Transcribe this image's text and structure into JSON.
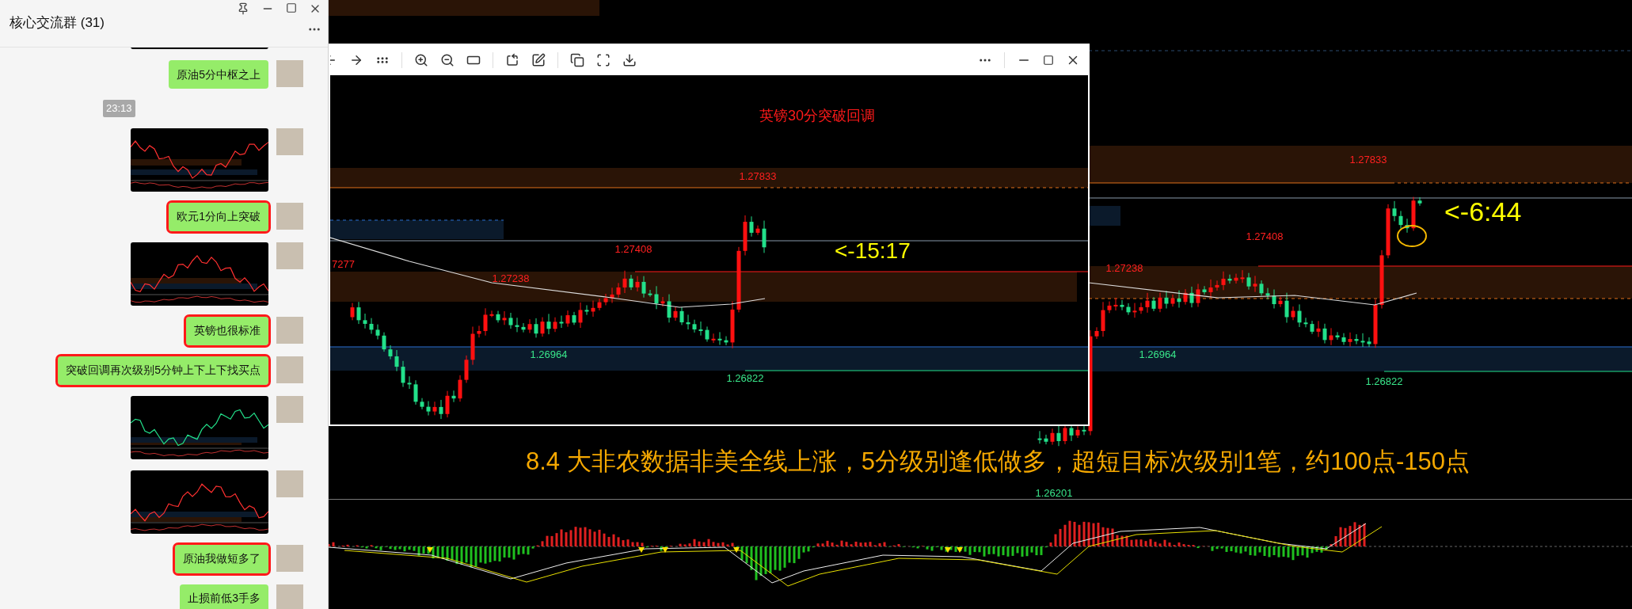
{
  "chat": {
    "title": "核心交流群 (31)",
    "messages": [
      {
        "kind": "image"
      },
      {
        "kind": "text",
        "text": "原油5分中枢之上",
        "highlighted": false
      },
      {
        "kind": "time",
        "text": "23:13"
      },
      {
        "kind": "image"
      },
      {
        "kind": "text",
        "text": "欧元1分向上突破",
        "highlighted": true
      },
      {
        "kind": "image"
      },
      {
        "kind": "text",
        "text": "英镑也很标准",
        "highlighted": true
      },
      {
        "kind": "text",
        "text": "突破回调再次级别5分钟上下上下找买点",
        "highlighted": true
      },
      {
        "kind": "image"
      },
      {
        "kind": "image"
      },
      {
        "kind": "text",
        "text": "原油我做短多了",
        "highlighted": true
      },
      {
        "kind": "text",
        "text": "止损前低3手多",
        "highlighted": false
      }
    ]
  },
  "viewer": {
    "title": "英镑30分突破回调",
    "annotation": "<-15:17",
    "labels": [
      {
        "text": "1.27833",
        "color": "#ff2020"
      },
      {
        "text": "1.27408",
        "color": "#ff2020"
      },
      {
        "text": "7277",
        "color": "#ff2020"
      },
      {
        "text": "1.27238",
        "color": "#ff2020"
      },
      {
        "text": "1.26964",
        "color": "#39e68a"
      },
      {
        "text": "1.26822",
        "color": "#39e68a"
      }
    ]
  },
  "main_chart": {
    "annotation": "<-6:44",
    "caption": "8.4 大非农数据非美全线上涨，5分级别逢低做多，超短目标次级别1笔，约100点-150点",
    "labels": [
      {
        "text": "1.27833",
        "color": "#ff2020"
      },
      {
        "text": "1.27408",
        "color": "#ff2020"
      },
      {
        "text": "1.27238",
        "color": "#ff2020"
      },
      {
        "text": "1.26964",
        "color": "#39e68a"
      },
      {
        "text": "1.26822",
        "color": "#39e68a"
      },
      {
        "text": "1.26201",
        "color": "#39e68a"
      }
    ]
  }
}
